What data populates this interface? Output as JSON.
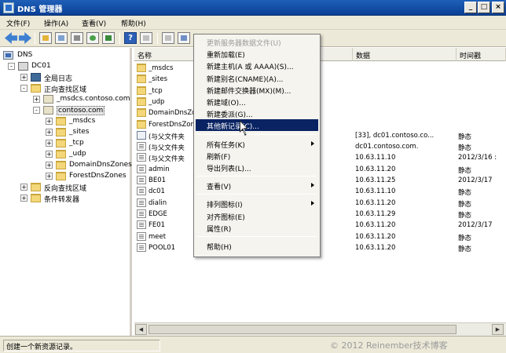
{
  "window": {
    "title": "DNS 管理器",
    "min": "_",
    "max": "□",
    "close": "×"
  },
  "menu": [
    "文件(F)",
    "操作(A)",
    "查看(V)",
    "帮助(H)"
  ],
  "toolbar": {
    "help_label": "?"
  },
  "tree": [
    {
      "label": "DNS",
      "icon": "dns-server-icon",
      "expand": ""
    },
    {
      "label": "DC01",
      "icon": "computer-icon",
      "expand": "-"
    },
    {
      "label": "全局日志",
      "icon": "log-icon",
      "expand": "+"
    },
    {
      "label": "正向查找区域",
      "icon": "folder-icon",
      "expand": "-"
    },
    {
      "label": "_msdcs.contoso.com",
      "icon": "zone-icon",
      "expand": "+"
    },
    {
      "label": "contoso.com",
      "icon": "zone-icon",
      "expand": "-"
    },
    {
      "label": "_msdcs",
      "icon": "folder-icon",
      "expand": "+"
    },
    {
      "label": "_sites",
      "icon": "folder-icon",
      "expand": "+"
    },
    {
      "label": "_tcp",
      "icon": "folder-icon",
      "expand": "+"
    },
    {
      "label": "_udp",
      "icon": "folder-icon",
      "expand": "+"
    },
    {
      "label": "DomainDnsZones",
      "icon": "folder-icon",
      "expand": "+"
    },
    {
      "label": "ForestDnsZones",
      "icon": "folder-icon",
      "expand": "+"
    },
    {
      "label": "反向查找区域",
      "icon": "folder-icon",
      "expand": "+"
    },
    {
      "label": "条件转发器",
      "icon": "folder-icon",
      "expand": "+"
    }
  ],
  "list": {
    "columns": [
      "名称",
      "数据",
      "时间戳"
    ],
    "rows": [
      {
        "name": "_msdcs",
        "data": "",
        "time": "",
        "icon": "folder"
      },
      {
        "name": "_sites",
        "data": "",
        "time": "",
        "icon": "folder"
      },
      {
        "name": "_tcp",
        "data": "",
        "time": "",
        "icon": "folder"
      },
      {
        "name": "_udp",
        "data": "",
        "time": "",
        "icon": "folder"
      },
      {
        "name": "DomainDnsZon",
        "data": "",
        "time": "",
        "icon": "folder"
      },
      {
        "name": "ForestDnsZon",
        "data": "",
        "time": "",
        "icon": "folder"
      },
      {
        "name": "(与父文件夹",
        "data": "[33], dc01.contoso.co...",
        "time": "静态",
        "icon": "soa"
      },
      {
        "name": "(与父文件夹",
        "data": "dc01.contoso.com.",
        "time": "静态",
        "icon": "file"
      },
      {
        "name": "(与父文件夹",
        "data": "10.63.11.10",
        "time": "2012/3/16 :",
        "icon": "file"
      },
      {
        "name": "admin",
        "data": "10.63.11.20",
        "time": "静态",
        "icon": "file"
      },
      {
        "name": "BE01",
        "data": "10.63.11.25",
        "time": "2012/3/17",
        "icon": "file"
      },
      {
        "name": "dc01",
        "data": "10.63.11.10",
        "time": "静态",
        "icon": "file"
      },
      {
        "name": "dialin",
        "data": "10.63.11.20",
        "time": "静态",
        "icon": "file"
      },
      {
        "name": "EDGE",
        "data": "10.63.11.29",
        "time": "静态",
        "icon": "file"
      },
      {
        "name": "FE01",
        "data": "10.63.11.20",
        "time": "2012/3/17",
        "icon": "file"
      },
      {
        "name": "meet",
        "data": "10.63.11.20",
        "time": "静态",
        "icon": "file"
      },
      {
        "name": "POOL01",
        "data": "10.63.11.20",
        "time": "静态",
        "icon": "file"
      }
    ]
  },
  "context_menu": {
    "items": [
      {
        "label": "更新服务器数据文件(U)",
        "disabled": true
      },
      {
        "label": "重新加载(E)"
      },
      {
        "label": "新建主机(A 或 AAAA)(S)..."
      },
      {
        "label": "新建别名(CNAME)(A)..."
      },
      {
        "label": "新建邮件交换器(MX)(M)..."
      },
      {
        "label": "新建域(O)..."
      },
      {
        "label": "新建委派(G)..."
      },
      {
        "label": "其他新记录(C)...",
        "highlighted": true
      },
      {
        "label": "所有任务(K)",
        "submenu": true
      },
      {
        "label": "刷新(F)"
      },
      {
        "label": "导出列表(L)..."
      },
      {
        "label": "查看(V)",
        "submenu": true
      },
      {
        "label": "排列图标(I)",
        "submenu": true
      },
      {
        "label": "对齐图标(E)"
      },
      {
        "label": "属性(R)"
      },
      {
        "label": "帮助(H)"
      }
    ]
  },
  "status": {
    "text": "创建一个新资源记录。",
    "watermark": "© 2012 Reinember技术博客"
  }
}
